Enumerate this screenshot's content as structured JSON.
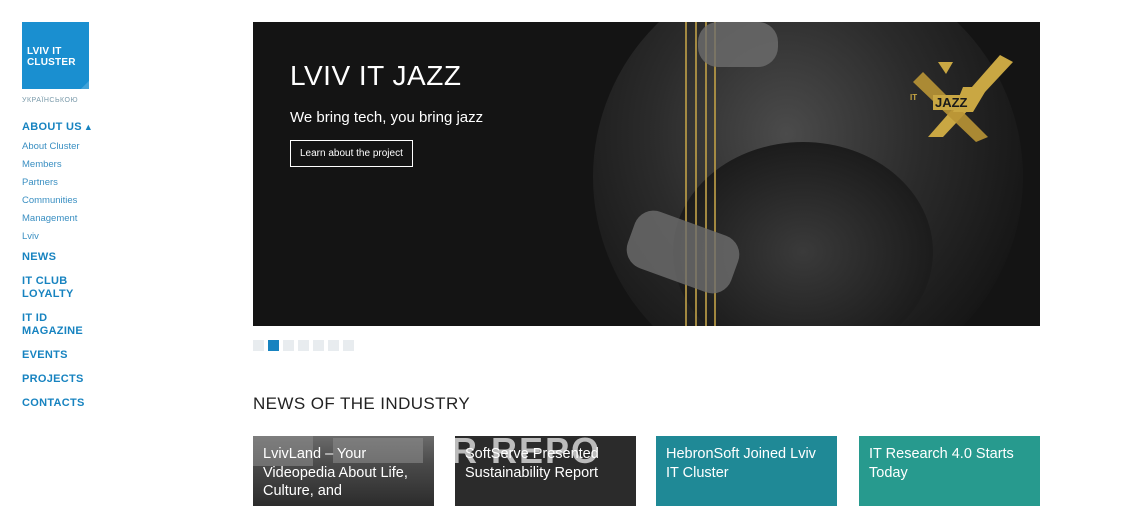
{
  "logo": {
    "line1": "LVIV IT",
    "line2": "CLUSTER"
  },
  "language_link": "УКРАЇНСЬКОЮ",
  "nav": {
    "about": "ABOUT US",
    "about_sub": [
      "About Cluster",
      "Members",
      "Partners",
      "Communities",
      "Management",
      "Lviv"
    ],
    "news": "NEWS",
    "it_club_1": "IT CLUB",
    "it_club_2": "LOYALTY",
    "it_id_1": "IT ID",
    "it_id_2": "MAGAZINE",
    "events": "EVENTS",
    "projects": "PROJECTS",
    "contacts": "CONTACTS"
  },
  "hero": {
    "title": "LVIV IT JAZZ",
    "subtitle": "We bring tech, you bring jazz",
    "button": "Learn about the project",
    "logo_it": "IT",
    "logo_jazz": "JAZZ"
  },
  "slider": {
    "total": 7,
    "active": 2
  },
  "news": {
    "heading": "NEWS OF THE INDUSTRY",
    "cards": [
      {
        "title": "LvivLand – Your Videopedia About Life, Culture, and",
        "color": "#4a4a4a"
      },
      {
        "title": "SoftServe Presented Sustainability Report",
        "bg_text": "R REPO",
        "color": "#2b2b2b"
      },
      {
        "title": "HebronSoft Joined Lviv IT Cluster",
        "color": "#1f8996"
      },
      {
        "title": "IT Research 4.0 Starts Today",
        "color": "#279a8e"
      }
    ]
  },
  "colors": {
    "accent": "#1783c0",
    "logo_bg": "#1a8fd0",
    "gold": "#c9a743"
  }
}
